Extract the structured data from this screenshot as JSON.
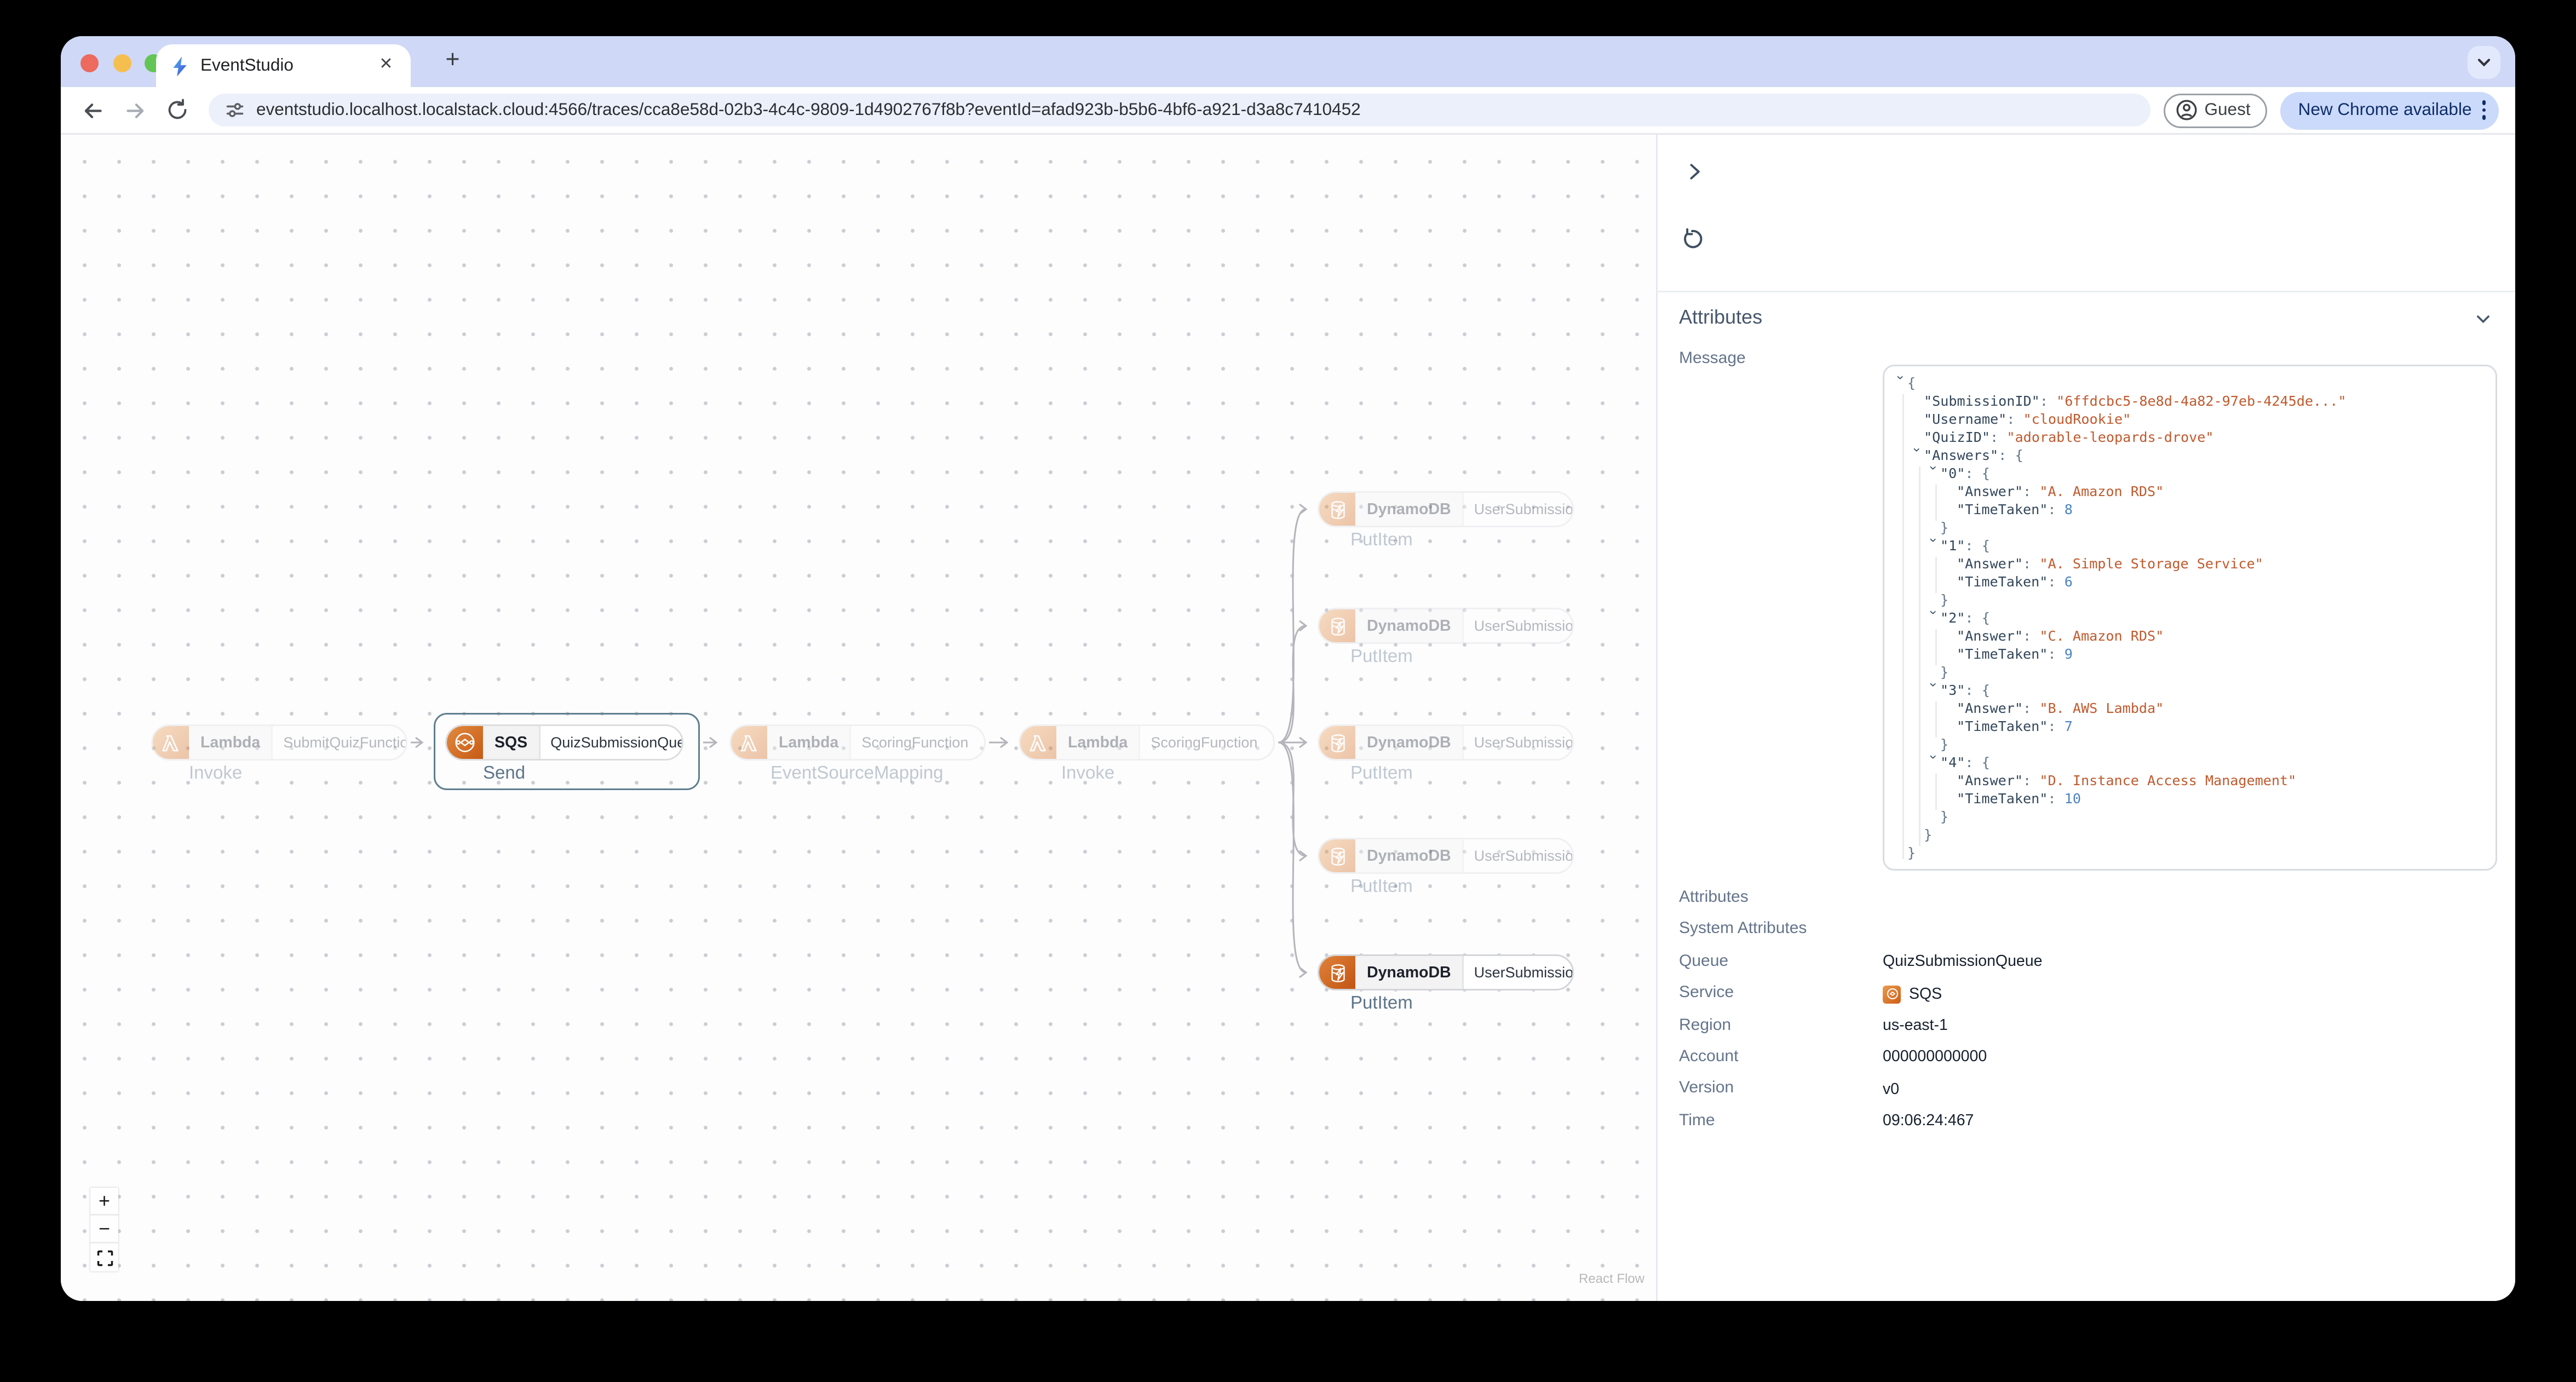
{
  "browser": {
    "tab_title": "EventStudio",
    "tab_close_glyph": "✕",
    "new_tab_glyph": "+",
    "url": "eventstudio.localhost.localstack.cloud:4566/traces/cca8e58d-02b3-4c4c-9809-1d4902767f8b?eventId=afad923b-b5b6-4bf6-a921-d3a8c7410452",
    "guest_label": "Guest",
    "update_label": "New Chrome available",
    "traffic_light_colors": [
      "#ec6a5e",
      "#f5bf4f",
      "#62c554"
    ]
  },
  "canvas": {
    "flow_nodes": [
      {
        "service": "Lambda",
        "name": "SubmitQuizFunction",
        "operation": "Invoke",
        "state": "faded"
      },
      {
        "service": "SQS",
        "name": "QuizSubmissionQueue",
        "operation": "Send",
        "state": "selected"
      },
      {
        "service": "Lambda",
        "name": "ScoringFunction",
        "operation": "EventSourceMapping",
        "state": "faded"
      },
      {
        "service": "Lambda",
        "name": "ScoringFunction",
        "operation": "Invoke",
        "state": "faded"
      },
      {
        "service": "DynamoDB",
        "name": "UserSubmissions",
        "operation": "PutItem",
        "state": "faded"
      },
      {
        "service": "DynamoDB",
        "name": "UserSubmissions",
        "operation": "PutItem",
        "state": "faded"
      },
      {
        "service": "DynamoDB",
        "name": "UserSubmissions",
        "operation": "PutItem",
        "state": "faded"
      },
      {
        "service": "DynamoDB",
        "name": "UserSubmissions",
        "operation": "PutItem",
        "state": "faded"
      },
      {
        "service": "DynamoDB",
        "name": "UserSubmissions",
        "operation": "PutItem",
        "state": "active"
      }
    ],
    "controls": {
      "zoom_in": "+",
      "zoom_out": "−"
    },
    "attribution": "React Flow"
  },
  "panel": {
    "header": "Attributes",
    "message_label": "Message",
    "json_lines": [
      {
        "ind": 0,
        "chev": true,
        "punc": "{"
      },
      {
        "ind": 1,
        "key": "SubmissionID",
        "str": "6ffdcbc5-8e8d-4a82-97eb-4245de..."
      },
      {
        "ind": 1,
        "key": "Username",
        "str": "cloudRookie"
      },
      {
        "ind": 1,
        "key": "QuizID",
        "str": "adorable-leopards-drove"
      },
      {
        "ind": 1,
        "chev": true,
        "key": "Answers",
        "punc": "{"
      },
      {
        "ind": 2,
        "chev": true,
        "key": "0",
        "punc": "{"
      },
      {
        "ind": 3,
        "key": "Answer",
        "str": "A. Amazon RDS"
      },
      {
        "ind": 3,
        "key": "TimeTaken",
        "num": "8"
      },
      {
        "ind": 2,
        "punc": "}"
      },
      {
        "ind": 2,
        "chev": true,
        "key": "1",
        "punc": "{"
      },
      {
        "ind": 3,
        "key": "Answer",
        "str": "A. Simple Storage Service"
      },
      {
        "ind": 3,
        "key": "TimeTaken",
        "num": "6"
      },
      {
        "ind": 2,
        "punc": "}"
      },
      {
        "ind": 2,
        "chev": true,
        "key": "2",
        "punc": "{"
      },
      {
        "ind": 3,
        "key": "Answer",
        "str": "C. Amazon RDS"
      },
      {
        "ind": 3,
        "key": "TimeTaken",
        "num": "9"
      },
      {
        "ind": 2,
        "punc": "}"
      },
      {
        "ind": 2,
        "chev": true,
        "key": "3",
        "punc": "{"
      },
      {
        "ind": 3,
        "key": "Answer",
        "str": "B. AWS Lambda"
      },
      {
        "ind": 3,
        "key": "TimeTaken",
        "num": "7"
      },
      {
        "ind": 2,
        "punc": "}"
      },
      {
        "ind": 2,
        "chev": true,
        "key": "4",
        "punc": "{"
      },
      {
        "ind": 3,
        "key": "Answer",
        "str": "D. Instance Access Management"
      },
      {
        "ind": 3,
        "key": "TimeTaken",
        "num": "10"
      },
      {
        "ind": 2,
        "punc": "}"
      },
      {
        "ind": 1,
        "punc": "}"
      },
      {
        "ind": 0,
        "punc": "}"
      }
    ],
    "rows": [
      {
        "label": "Attributes",
        "value": ""
      },
      {
        "label": "System Attributes",
        "value": ""
      },
      {
        "label": "Queue",
        "value": "QuizSubmissionQueue"
      },
      {
        "label": "Service",
        "value": "SQS",
        "icon": "sqs"
      },
      {
        "label": "Region",
        "value": "us-east-1"
      },
      {
        "label": "Account",
        "value": "000000000000"
      },
      {
        "label": "Version",
        "value": "v0"
      },
      {
        "label": "Time",
        "value": "09:06:24:467"
      }
    ]
  },
  "colors": {
    "aws_orange": "#d2691f",
    "selection_border": "#5e7e8e",
    "edge": "#b4b4ba",
    "json_key": "#33475b",
    "json_string": "#c05a2e",
    "json_number": "#4a82c3"
  }
}
